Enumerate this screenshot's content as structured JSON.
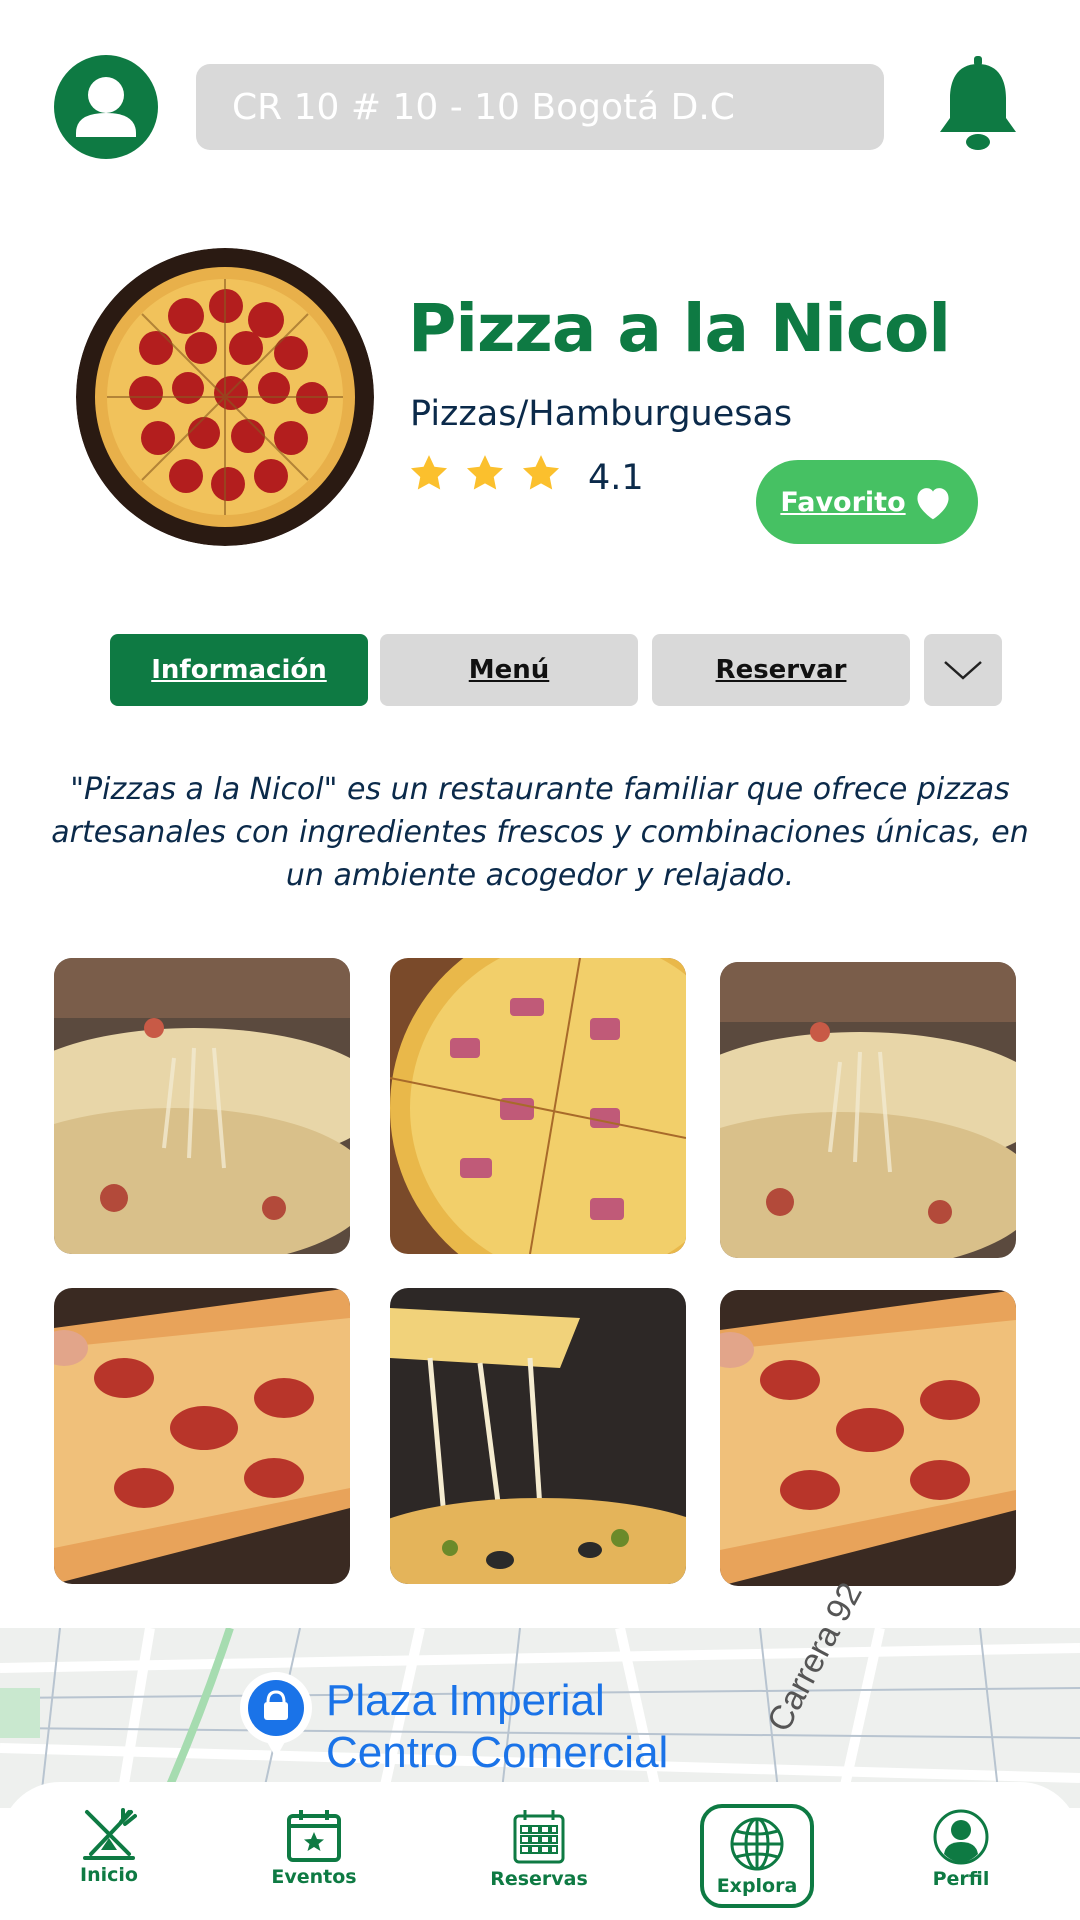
{
  "header": {
    "address_placeholder": "CR 10 # 10 - 10 Bogotá D.C"
  },
  "restaurant": {
    "name": "Pizza a la Nicol",
    "category": "Pizzas/Hamburguesas",
    "stars_shown": 3,
    "rating": "4.1",
    "favorite_label": "Favorito"
  },
  "tabs": [
    {
      "label": "Información",
      "active": true
    },
    {
      "label": "Menú",
      "active": false
    },
    {
      "label": "Reservar",
      "active": false
    }
  ],
  "description": "\"Pizzas a la Nicol\" es un restaurante familiar que ofrece pizzas artesanales con ingredientes frescos y combinaciones únicas, en un ambiente acogedor y relajado.",
  "map": {
    "place_line1": "Plaza Imperial",
    "place_line2": "Centro Comercial",
    "street": "Carrera 92"
  },
  "nav": [
    {
      "label": "Inicio",
      "icon": "fork-knife-icon"
    },
    {
      "label": "Eventos",
      "icon": "calendar-star-icon"
    },
    {
      "label": "Reservas",
      "icon": "calendar-grid-icon"
    },
    {
      "label": "Explora",
      "icon": "globe-icon",
      "active": true
    },
    {
      "label": "Perfil",
      "icon": "profile-icon"
    }
  ],
  "colors": {
    "brand_green": "#0e7a43",
    "favorite_green": "#46c163",
    "star_yellow": "#fbc02d",
    "text_navy": "#0b2a4a",
    "inactive_gray": "#d9d9d9"
  }
}
